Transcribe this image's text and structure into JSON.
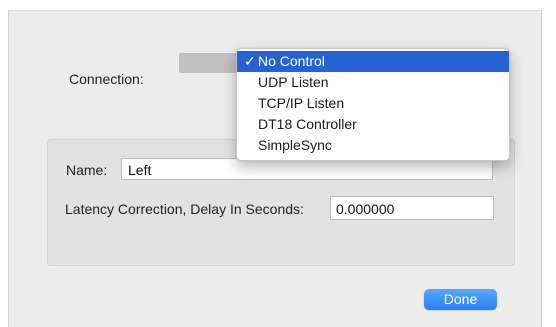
{
  "connection": {
    "label": "Connection:",
    "menu": {
      "items": [
        {
          "label": "No Control",
          "checked": true,
          "check_mark": "✓"
        },
        {
          "label": "UDP Listen",
          "checked": false,
          "check_mark": ""
        },
        {
          "label": "TCP/IP Listen",
          "checked": false,
          "check_mark": ""
        },
        {
          "label": "DT18 Controller",
          "checked": false,
          "check_mark": ""
        },
        {
          "label": "SimpleSync",
          "checked": false,
          "check_mark": ""
        }
      ],
      "highlight_color": "#2463d1"
    }
  },
  "settings": {
    "name_label": "Name:",
    "name_value": "Left",
    "latency_label": "Latency Correction, Delay In Seconds:",
    "latency_value": "0.000000"
  },
  "footer": {
    "done_label": "Done",
    "accent_color": "#2a7ef5"
  }
}
